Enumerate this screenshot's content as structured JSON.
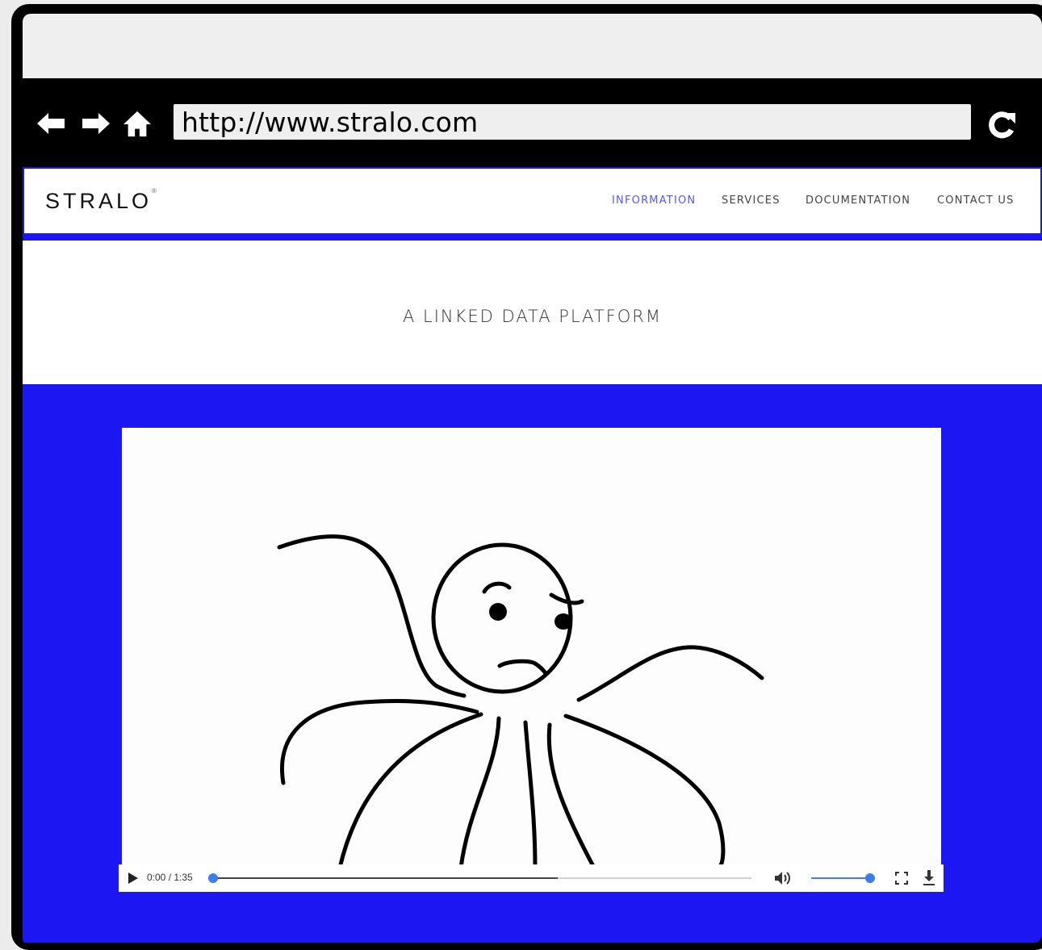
{
  "browser": {
    "url": "http://www.stralo.com",
    "icons": [
      "back-arrow-icon",
      "forward-arrow-icon",
      "home-icon",
      "reload-icon"
    ]
  },
  "site": {
    "logo": "STRALO",
    "logo_mark": "®",
    "nav": [
      {
        "label": "INFORMATION",
        "active": true
      },
      {
        "label": "SERVICES",
        "active": false
      },
      {
        "label": "DOCUMENTATION",
        "active": false
      },
      {
        "label": "CONTACT US",
        "active": false
      }
    ],
    "tagline": "A LINKED DATA PLATFORM"
  },
  "video": {
    "time": "0:00 / 1:35",
    "progress": 0.0,
    "buffered": 0.64,
    "volume": 1.0,
    "icons": [
      "play-icon",
      "volume-icon",
      "fullscreen-icon",
      "download-icon"
    ]
  },
  "colors": {
    "brand_blue": "#1c16f2",
    "active_nav": "#5a55f0",
    "player_accent": "#3d7ee6"
  }
}
